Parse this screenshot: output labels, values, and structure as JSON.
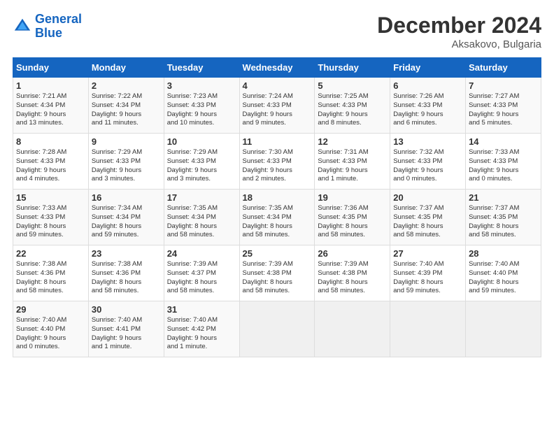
{
  "header": {
    "logo_line1": "General",
    "logo_line2": "Blue",
    "month": "December 2024",
    "location": "Aksakovo, Bulgaria"
  },
  "weekdays": [
    "Sunday",
    "Monday",
    "Tuesday",
    "Wednesday",
    "Thursday",
    "Friday",
    "Saturday"
  ],
  "weeks": [
    [
      {
        "day": "1",
        "info": "Sunrise: 7:21 AM\nSunset: 4:34 PM\nDaylight: 9 hours\nand 13 minutes."
      },
      {
        "day": "2",
        "info": "Sunrise: 7:22 AM\nSunset: 4:34 PM\nDaylight: 9 hours\nand 11 minutes."
      },
      {
        "day": "3",
        "info": "Sunrise: 7:23 AM\nSunset: 4:33 PM\nDaylight: 9 hours\nand 10 minutes."
      },
      {
        "day": "4",
        "info": "Sunrise: 7:24 AM\nSunset: 4:33 PM\nDaylight: 9 hours\nand 9 minutes."
      },
      {
        "day": "5",
        "info": "Sunrise: 7:25 AM\nSunset: 4:33 PM\nDaylight: 9 hours\nand 8 minutes."
      },
      {
        "day": "6",
        "info": "Sunrise: 7:26 AM\nSunset: 4:33 PM\nDaylight: 9 hours\nand 6 minutes."
      },
      {
        "day": "7",
        "info": "Sunrise: 7:27 AM\nSunset: 4:33 PM\nDaylight: 9 hours\nand 5 minutes."
      }
    ],
    [
      {
        "day": "8",
        "info": "Sunrise: 7:28 AM\nSunset: 4:33 PM\nDaylight: 9 hours\nand 4 minutes."
      },
      {
        "day": "9",
        "info": "Sunrise: 7:29 AM\nSunset: 4:33 PM\nDaylight: 9 hours\nand 3 minutes."
      },
      {
        "day": "10",
        "info": "Sunrise: 7:29 AM\nSunset: 4:33 PM\nDaylight: 9 hours\nand 3 minutes."
      },
      {
        "day": "11",
        "info": "Sunrise: 7:30 AM\nSunset: 4:33 PM\nDaylight: 9 hours\nand 2 minutes."
      },
      {
        "day": "12",
        "info": "Sunrise: 7:31 AM\nSunset: 4:33 PM\nDaylight: 9 hours\nand 1 minute."
      },
      {
        "day": "13",
        "info": "Sunrise: 7:32 AM\nSunset: 4:33 PM\nDaylight: 9 hours\nand 0 minutes."
      },
      {
        "day": "14",
        "info": "Sunrise: 7:33 AM\nSunset: 4:33 PM\nDaylight: 9 hours\nand 0 minutes."
      }
    ],
    [
      {
        "day": "15",
        "info": "Sunrise: 7:33 AM\nSunset: 4:33 PM\nDaylight: 8 hours\nand 59 minutes."
      },
      {
        "day": "16",
        "info": "Sunrise: 7:34 AM\nSunset: 4:34 PM\nDaylight: 8 hours\nand 59 minutes."
      },
      {
        "day": "17",
        "info": "Sunrise: 7:35 AM\nSunset: 4:34 PM\nDaylight: 8 hours\nand 58 minutes."
      },
      {
        "day": "18",
        "info": "Sunrise: 7:35 AM\nSunset: 4:34 PM\nDaylight: 8 hours\nand 58 minutes."
      },
      {
        "day": "19",
        "info": "Sunrise: 7:36 AM\nSunset: 4:35 PM\nDaylight: 8 hours\nand 58 minutes."
      },
      {
        "day": "20",
        "info": "Sunrise: 7:37 AM\nSunset: 4:35 PM\nDaylight: 8 hours\nand 58 minutes."
      },
      {
        "day": "21",
        "info": "Sunrise: 7:37 AM\nSunset: 4:35 PM\nDaylight: 8 hours\nand 58 minutes."
      }
    ],
    [
      {
        "day": "22",
        "info": "Sunrise: 7:38 AM\nSunset: 4:36 PM\nDaylight: 8 hours\nand 58 minutes."
      },
      {
        "day": "23",
        "info": "Sunrise: 7:38 AM\nSunset: 4:36 PM\nDaylight: 8 hours\nand 58 minutes."
      },
      {
        "day": "24",
        "info": "Sunrise: 7:39 AM\nSunset: 4:37 PM\nDaylight: 8 hours\nand 58 minutes."
      },
      {
        "day": "25",
        "info": "Sunrise: 7:39 AM\nSunset: 4:38 PM\nDaylight: 8 hours\nand 58 minutes."
      },
      {
        "day": "26",
        "info": "Sunrise: 7:39 AM\nSunset: 4:38 PM\nDaylight: 8 hours\nand 58 minutes."
      },
      {
        "day": "27",
        "info": "Sunrise: 7:40 AM\nSunset: 4:39 PM\nDaylight: 8 hours\nand 59 minutes."
      },
      {
        "day": "28",
        "info": "Sunrise: 7:40 AM\nSunset: 4:40 PM\nDaylight: 8 hours\nand 59 minutes."
      }
    ],
    [
      {
        "day": "29",
        "info": "Sunrise: 7:40 AM\nSunset: 4:40 PM\nDaylight: 9 hours\nand 0 minutes."
      },
      {
        "day": "30",
        "info": "Sunrise: 7:40 AM\nSunset: 4:41 PM\nDaylight: 9 hours\nand 1 minute."
      },
      {
        "day": "31",
        "info": "Sunrise: 7:40 AM\nSunset: 4:42 PM\nDaylight: 9 hours\nand 1 minute."
      },
      null,
      null,
      null,
      null
    ]
  ]
}
